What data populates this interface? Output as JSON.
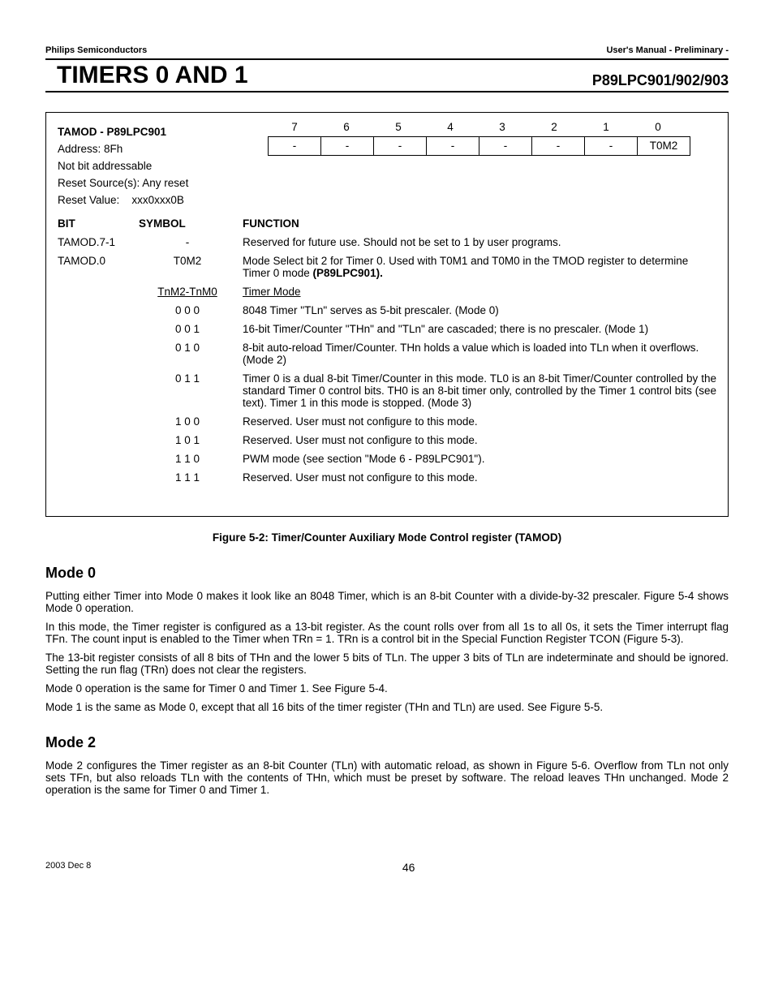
{
  "header": {
    "left": "Philips Semiconductors",
    "right": "User's Manual - Preliminary -"
  },
  "title": {
    "main": "TIMERS 0 AND 1",
    "part": "P89LPC901/902/903"
  },
  "register": {
    "name": "TAMOD - P89LPC901",
    "address_label": "Address: 8Fh",
    "addressable": "Not bit addressable",
    "reset_source": "Reset Source(s): Any reset",
    "reset_value_label": "Reset Value:",
    "reset_value": "xxx0xxx0B",
    "bit_numbers": [
      "7",
      "6",
      "5",
      "4",
      "3",
      "2",
      "1",
      "0"
    ],
    "bit_cells": [
      "-",
      "-",
      "-",
      "-",
      "-",
      "-",
      "-",
      "T0M2"
    ],
    "col_heads": {
      "bit": "BIT",
      "symbol": "SYMBOL",
      "function": "FUNCTION"
    },
    "rows": [
      {
        "bit": "TAMOD.7-1",
        "symbol": "-",
        "function": "Reserved for future use. Should not be set to 1 by user programs."
      },
      {
        "bit": "TAMOD.0",
        "symbol": "T0M2",
        "function": "Mode Select bit 2 for Timer 0. Used with T0M1 and T0M0 in the TMOD register to determine Timer 0 mode (P89LPC901)."
      }
    ],
    "mode_head_symbol": "TnM2-TnM0",
    "mode_head_func": "Timer Mode",
    "modes": [
      {
        "code": "0 0 0",
        "desc": "8048 Timer \"TLn\" serves as 5-bit prescaler. (Mode 0)"
      },
      {
        "code": "0 0 1",
        "desc": "16-bit Timer/Counter \"THn\" and \"TLn\" are cascaded; there is no prescaler. (Mode 1)"
      },
      {
        "code": "0 1 0",
        "desc": "8-bit auto-reload Timer/Counter. THn holds a value which is loaded into TLn when it overflows. (Mode 2)"
      },
      {
        "code": "0 1 1",
        "desc": "Timer 0 is a dual 8-bit Timer/Counter in this mode. TL0 is an 8-bit Timer/Counter controlled by the standard Timer 0 control bits. TH0 is an 8-bit timer only, controlled by the Timer 1 control bits (see text). Timer 1 in this mode is stopped. (Mode 3)"
      },
      {
        "code": "1 0 0",
        "desc": "Reserved. User must not configure to this mode."
      },
      {
        "code": "1 0 1",
        "desc": "Reserved. User must not configure to this mode."
      },
      {
        "code": "1 1 0",
        "desc": "PWM mode (see section \"Mode 6 - P89LPC901\")."
      },
      {
        "code": "1 1 1",
        "desc": "Reserved. User must not configure to this mode."
      }
    ]
  },
  "caption": "Figure 5-2: Timer/Counter Auxiliary Mode Control register (TAMOD)",
  "sections": {
    "mode0": {
      "title": "Mode 0",
      "p1": "Putting either Timer into Mode 0 makes it look like an 8048 Timer, which is an 8-bit Counter with a divide-by-32 prescaler. Figure 5-4 shows Mode 0 operation.",
      "p2": "In this mode, the Timer register is configured as a 13-bit register. As the count rolls over from all 1s to all 0s, it sets the Timer interrupt flag TFn. The count input is enabled to the Timer when TRn = 1. TRn is a control bit in the Special Function Register TCON (Figure 5-3).",
      "p3": "The 13-bit register consists of all 8 bits of THn and the lower 5 bits of TLn. The upper 3 bits of TLn are indeterminate and should be ignored. Setting the run flag (TRn) does not clear the registers.",
      "p4": "Mode 0 operation is the same for Timer 0 and Timer 1. See Figure 5-4.",
      "p5": "Mode 1 is the same as Mode 0, except that all 16 bits of the timer register (THn and TLn) are used. See Figure 5-5."
    },
    "mode2": {
      "title": "Mode 2",
      "p1": "Mode 2 configures the Timer register as an 8-bit Counter (TLn) with automatic reload, as shown in Figure 5-6. Overflow from TLn not only sets TFn, but also reloads TLn with the contents of THn, which must be preset by software. The reload leaves THn unchanged. Mode 2 operation is the same for Timer 0 and Timer 1."
    }
  },
  "footer": {
    "date": "2003 Dec 8",
    "page": "46"
  }
}
